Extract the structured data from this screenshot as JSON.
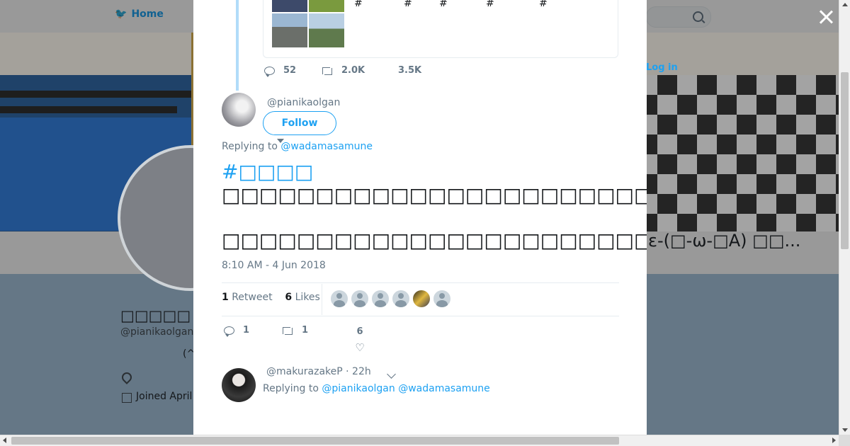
{
  "background": {
    "nav": {
      "home_label": "Home",
      "login_label": "Log in"
    },
    "profile": {
      "name": "□□□□□",
      "handle": "@pianikaolgan",
      "bio": "(^",
      "joined": "Joined April"
    },
    "right_text": "ε-(□-ω-□A) □□..."
  },
  "close_label": "×",
  "previous_tweet": {
    "hashtags": [
      "#",
      "#",
      "#",
      "#",
      "#"
    ],
    "reply_count": "52",
    "retweet_count": "2.0K",
    "like_count": "3.5K"
  },
  "tweet": {
    "handle": "@pianikaolgan",
    "follow_label": "Follow",
    "replying_label": "Replying to",
    "replying_to": "@wadamasamune",
    "hashtag": "#□□□□",
    "line1": "□□□□□□□□□□□□□□□□□□□□□□□□□□□□□□□m(_ _)m",
    "line2": "□□□□□□□□□□□□□□□□□□□□□□□□□□□□□□□□□□□□□□□□□□□□□□□□□□ε-(□-ω-□A) □□...",
    "timestamp": "8:10 AM - 4 Jun 2018",
    "retweets_num": "1",
    "retweets_label": "Retweet",
    "likes_num": "6",
    "likes_label": "Likes",
    "reply_count": "1",
    "retweet_count": "1",
    "like_count": "6"
  },
  "reply": {
    "handle": "@makurazakeP",
    "time": "· 22h",
    "replying_label": "Replying to",
    "to1": "@pianikaolgan",
    "to2": "@wadamasamune"
  },
  "colors": {
    "accent": "#1da1f2",
    "muted": "#657786",
    "thread_line": "#b1dcf9"
  }
}
